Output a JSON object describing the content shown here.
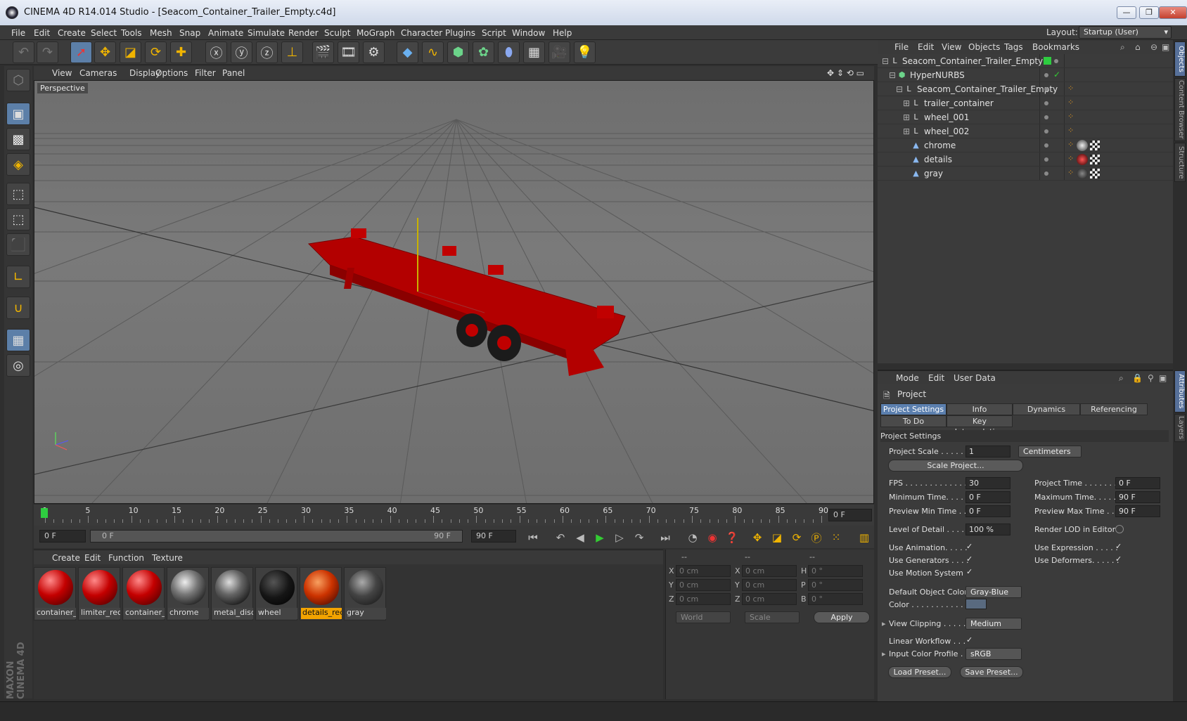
{
  "window": {
    "title": "CINEMA 4D R14.014 Studio - [Seacom_Container_Trailer_Empty.c4d]",
    "min": "—",
    "max": "❐",
    "close": "✕"
  },
  "menu": [
    "File",
    "Edit",
    "Create",
    "Select",
    "Tools",
    "Mesh",
    "Snap",
    "Animate",
    "Simulate",
    "Render",
    "Sculpt",
    "MoGraph",
    "Character",
    "Plugins",
    "Script",
    "Window",
    "Help"
  ],
  "layout": {
    "label": "Layout:",
    "value": "Startup (User)"
  },
  "viewport": {
    "menu": [
      "View",
      "Cameras",
      "Display",
      "Options",
      "Filter",
      "Panel"
    ],
    "label": "Perspective"
  },
  "timeline": {
    "ticks": [
      "0",
      "5",
      "10",
      "15",
      "20",
      "25",
      "30",
      "35",
      "40",
      "45",
      "50",
      "55",
      "60",
      "65",
      "70",
      "75",
      "80",
      "85",
      "90"
    ],
    "current": "0 F"
  },
  "transport": {
    "start": "0 F",
    "slider_left": "0 F",
    "slider_right": "90 F",
    "end": "90 F"
  },
  "materials": {
    "menu": [
      "Create",
      "Edit",
      "Function",
      "Texture"
    ],
    "items": [
      {
        "name": "container_l",
        "color": "#c40000"
      },
      {
        "name": "limiter_red",
        "color": "#c40000"
      },
      {
        "name": "container_l",
        "color": "#c40000"
      },
      {
        "name": "chrome",
        "color": "#888888"
      },
      {
        "name": "metal_disc",
        "color": "#777777"
      },
      {
        "name": "wheel",
        "color": "#151515"
      },
      {
        "name": "details_red",
        "color": "#cc3300"
      },
      {
        "name": "gray",
        "color": "#444444"
      }
    ]
  },
  "coords": {
    "headers": [
      "--",
      "--",
      "--"
    ],
    "rows": [
      {
        "a": "X",
        "av": "0 cm",
        "b": "X",
        "bv": "0 cm",
        "c": "H",
        "cv": "0 °"
      },
      {
        "a": "Y",
        "av": "0 cm",
        "b": "Y",
        "bv": "0 cm",
        "c": "P",
        "cv": "0 °"
      },
      {
        "a": "Z",
        "av": "0 cm",
        "b": "Z",
        "bv": "0 cm",
        "c": "B",
        "cv": "0 °"
      }
    ],
    "space": "World",
    "mode": "Scale",
    "apply": "Apply"
  },
  "objects": {
    "menu": [
      "File",
      "Edit",
      "View",
      "Objects",
      "Tags",
      "Bookmarks"
    ],
    "tree": [
      {
        "name": "Seacom_Container_Trailer_Empty"
      },
      {
        "name": "HyperNURBS"
      },
      {
        "name": "Seacom_Container_Trailer_Empty"
      },
      {
        "name": "trailer_container"
      },
      {
        "name": "wheel_001"
      },
      {
        "name": "wheel_002"
      },
      {
        "name": "chrome"
      },
      {
        "name": "details"
      },
      {
        "name": "gray"
      }
    ]
  },
  "sidetabs": [
    "Objects",
    "Content Browser",
    "Structure",
    "Attributes",
    "Layers"
  ],
  "attributes": {
    "menu": [
      "Mode",
      "Edit",
      "User Data"
    ],
    "header": "Project",
    "tabs": [
      "Project Settings",
      "Info",
      "Dynamics",
      "Referencing",
      "To Do",
      "Key Interpolation"
    ],
    "section": "Project Settings",
    "project_scale_label": "Project Scale . . . . . .",
    "project_scale": "1",
    "units": "Centimeters",
    "scale_project": "Scale Project...",
    "fps_label": "FPS . . . . . . . . . . . . . .",
    "fps": "30",
    "project_time_label": "Project Time . . . . . . . .",
    "project_time": "0 F",
    "min_time_label": "Minimum Time. . . . .",
    "min_time": "0 F",
    "max_time_label": "Maximum Time. . . . . .",
    "max_time": "90 F",
    "prev_min_label": "Preview Min Time . .",
    "prev_min": "0 F",
    "prev_max_label": "Preview Max Time . . .",
    "prev_max": "90 F",
    "lod_label": "Level of Detail . . . . .",
    "lod": "100 %",
    "render_lod_label": "Render LOD in Editor",
    "use_anim_label": "Use Animation. . . . .",
    "use_expr_label": "Use Expression . . . . .",
    "use_gen_label": "Use Generators . . . .",
    "use_def_label": "Use Deformers. . . . . .",
    "use_motion_label": "Use Motion System",
    "def_obj_color_label": "Default Object Color",
    "def_obj_color": "Gray-Blue",
    "color_label": "Color . . . . . . . . . . .",
    "view_clip_label": "View Clipping . . . . . .",
    "view_clip": "Medium",
    "linear_wf_label": "Linear Workflow . . .",
    "input_cp_label": "Input Color Profile . .",
    "input_cp": "sRGB",
    "load_preset": "Load Preset...",
    "save_preset": "Save Preset...",
    "check": "✓"
  },
  "logo": "MAXON CINEMA 4D"
}
